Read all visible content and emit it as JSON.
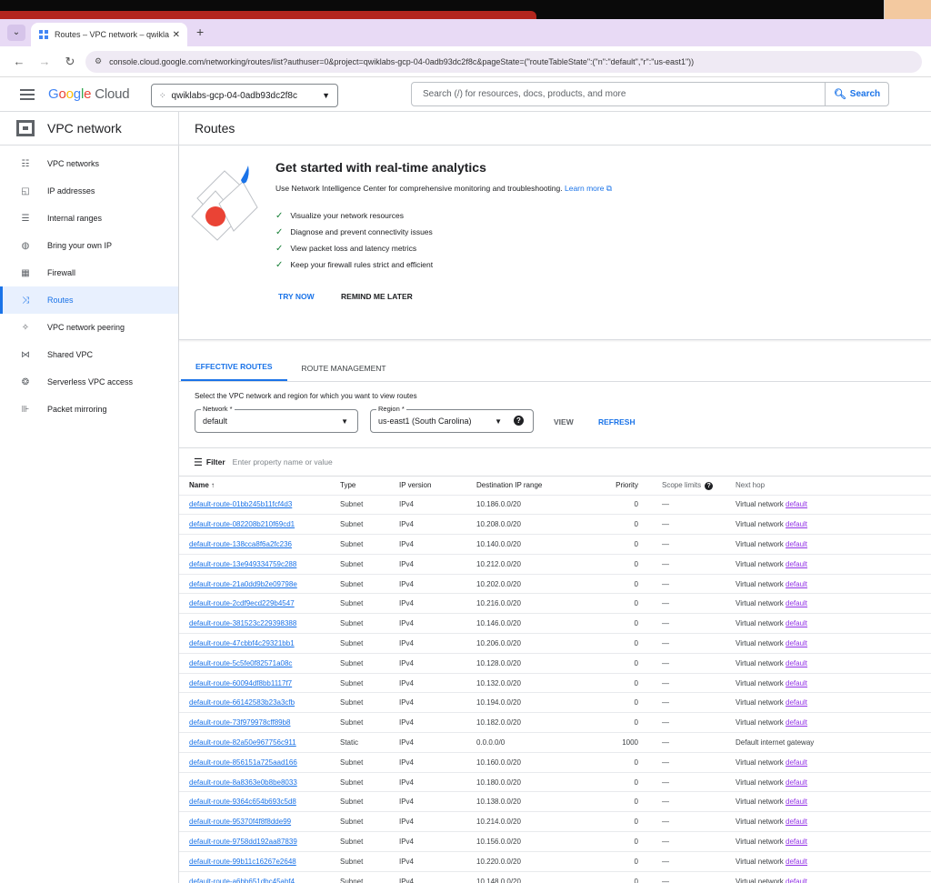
{
  "browser": {
    "tab_title": "Routes – VPC network – qwiklab",
    "tab_close": "✕",
    "new_tab": "+",
    "url": "console.cloud.google.com/networking/routes/list?authuser=0&project=qwiklabs-gcp-04-0adb93dc2f8c&pageState=(\"routeTableState\":(\"n\":\"default\",\"r\":\"us-east1\"))"
  },
  "header": {
    "project": "qwiklabs-gcp-04-0adb93dc2f8c",
    "search_placeholder": "Search (/) for resources, docs, products, and more",
    "search_button": "Search"
  },
  "sidebar": {
    "title": "VPC network",
    "items": [
      {
        "label": "VPC networks",
        "icon": "vpc-networks-icon",
        "glyph": "☷"
      },
      {
        "label": "IP addresses",
        "icon": "ip-addresses-icon",
        "glyph": "◱"
      },
      {
        "label": "Internal ranges",
        "icon": "internal-ranges-icon",
        "glyph": "☰"
      },
      {
        "label": "Bring your own IP",
        "icon": "globe-icon",
        "glyph": "◍"
      },
      {
        "label": "Firewall",
        "icon": "firewall-icon",
        "glyph": "▦"
      },
      {
        "label": "Routes",
        "icon": "routes-icon",
        "glyph": "⤨"
      },
      {
        "label": "VPC network peering",
        "icon": "peering-icon",
        "glyph": "✧"
      },
      {
        "label": "Shared VPC",
        "icon": "shared-vpc-icon",
        "glyph": "⋈"
      },
      {
        "label": "Serverless VPC access",
        "icon": "serverless-icon",
        "glyph": "❂"
      },
      {
        "label": "Packet mirroring",
        "icon": "packet-mirroring-icon",
        "glyph": "⊪"
      }
    ],
    "active_index": 5
  },
  "main": {
    "title": "Routes",
    "promo": {
      "heading": "Get started with real-time analytics",
      "description": "Use Network Intelligence Center for comprehensive monitoring and troubleshooting.",
      "learn_more": "Learn more",
      "bullets": [
        "Visualize your network resources",
        "Diagnose and prevent connectivity issues",
        "View packet loss and latency metrics",
        "Keep your firewall rules strict and efficient"
      ],
      "try_now": "TRY NOW",
      "remind_later": "REMIND ME LATER"
    },
    "tabs": [
      "EFFECTIVE ROUTES",
      "ROUTE MANAGEMENT"
    ],
    "select_desc": "Select the VPC network and region for which you want to view routes",
    "network_label": "Network *",
    "network_value": "default",
    "region_label": "Region *",
    "region_value": "us-east1 (South Carolina)",
    "view": "VIEW",
    "refresh": "REFRESH",
    "filter_label": "Filter",
    "filter_placeholder": "Enter property name or value",
    "columns": [
      "Name",
      "Type",
      "IP version",
      "Destination IP range",
      "Priority",
      "Scope limits",
      "Next hop"
    ],
    "sort_arrow": "↑",
    "rows": [
      [
        "default-route-01bb245b11fcf4d3",
        "Subnet",
        "IPv4",
        "10.186.0.0/20",
        "0",
        "—",
        "Virtual network",
        "default"
      ],
      [
        "default-route-082208b210f69cd1",
        "Subnet",
        "IPv4",
        "10.208.0.0/20",
        "0",
        "—",
        "Virtual network",
        "default"
      ],
      [
        "default-route-138cca8f6a2fc236",
        "Subnet",
        "IPv4",
        "10.140.0.0/20",
        "0",
        "—",
        "Virtual network",
        "default"
      ],
      [
        "default-route-13e949334759c288",
        "Subnet",
        "IPv4",
        "10.212.0.0/20",
        "0",
        "—",
        "Virtual network",
        "default"
      ],
      [
        "default-route-21a0dd9b2e09798e",
        "Subnet",
        "IPv4",
        "10.202.0.0/20",
        "0",
        "—",
        "Virtual network",
        "default"
      ],
      [
        "default-route-2cdf9ecd229b4547",
        "Subnet",
        "IPv4",
        "10.216.0.0/20",
        "0",
        "—",
        "Virtual network",
        "default"
      ],
      [
        "default-route-381523c229398388",
        "Subnet",
        "IPv4",
        "10.146.0.0/20",
        "0",
        "—",
        "Virtual network",
        "default"
      ],
      [
        "default-route-47cbbf4c29321bb1",
        "Subnet",
        "IPv4",
        "10.206.0.0/20",
        "0",
        "—",
        "Virtual network",
        "default"
      ],
      [
        "default-route-5c5fe0f82571a08c",
        "Subnet",
        "IPv4",
        "10.128.0.0/20",
        "0",
        "—",
        "Virtual network",
        "default"
      ],
      [
        "default-route-60094df8bb1117f7",
        "Subnet",
        "IPv4",
        "10.132.0.0/20",
        "0",
        "—",
        "Virtual network",
        "default"
      ],
      [
        "default-route-66142583b23a3cfb",
        "Subnet",
        "IPv4",
        "10.194.0.0/20",
        "0",
        "—",
        "Virtual network",
        "default"
      ],
      [
        "default-route-73f979978cff89b8",
        "Subnet",
        "IPv4",
        "10.182.0.0/20",
        "0",
        "—",
        "Virtual network",
        "default"
      ],
      [
        "default-route-82a50e967756c911",
        "Static",
        "IPv4",
        "0.0.0.0/0",
        "1000",
        "—",
        "Default internet gateway",
        ""
      ],
      [
        "default-route-856151a725aad166",
        "Subnet",
        "IPv4",
        "10.160.0.0/20",
        "0",
        "—",
        "Virtual network",
        "default"
      ],
      [
        "default-route-8a8363e0b8be8033",
        "Subnet",
        "IPv4",
        "10.180.0.0/20",
        "0",
        "—",
        "Virtual network",
        "default"
      ],
      [
        "default-route-9364c654b693c5d8",
        "Subnet",
        "IPv4",
        "10.138.0.0/20",
        "0",
        "—",
        "Virtual network",
        "default"
      ],
      [
        "default-route-95370f4f8f8dde99",
        "Subnet",
        "IPv4",
        "10.214.0.0/20",
        "0",
        "—",
        "Virtual network",
        "default"
      ],
      [
        "default-route-9758dd192aa87839",
        "Subnet",
        "IPv4",
        "10.156.0.0/20",
        "0",
        "—",
        "Virtual network",
        "default"
      ],
      [
        "default-route-99b11c16267e2648",
        "Subnet",
        "IPv4",
        "10.220.0.0/20",
        "0",
        "—",
        "Virtual network",
        "default"
      ],
      [
        "default-route-a6bb651dbc45abf4",
        "Subnet",
        "IPv4",
        "10.148.0.0/20",
        "0",
        "—",
        "Virtual network",
        "default"
      ]
    ]
  },
  "colors": {
    "accent": "#1a73e8",
    "hop_link": "#9334e6",
    "tab_bar": "#e8daf5"
  }
}
